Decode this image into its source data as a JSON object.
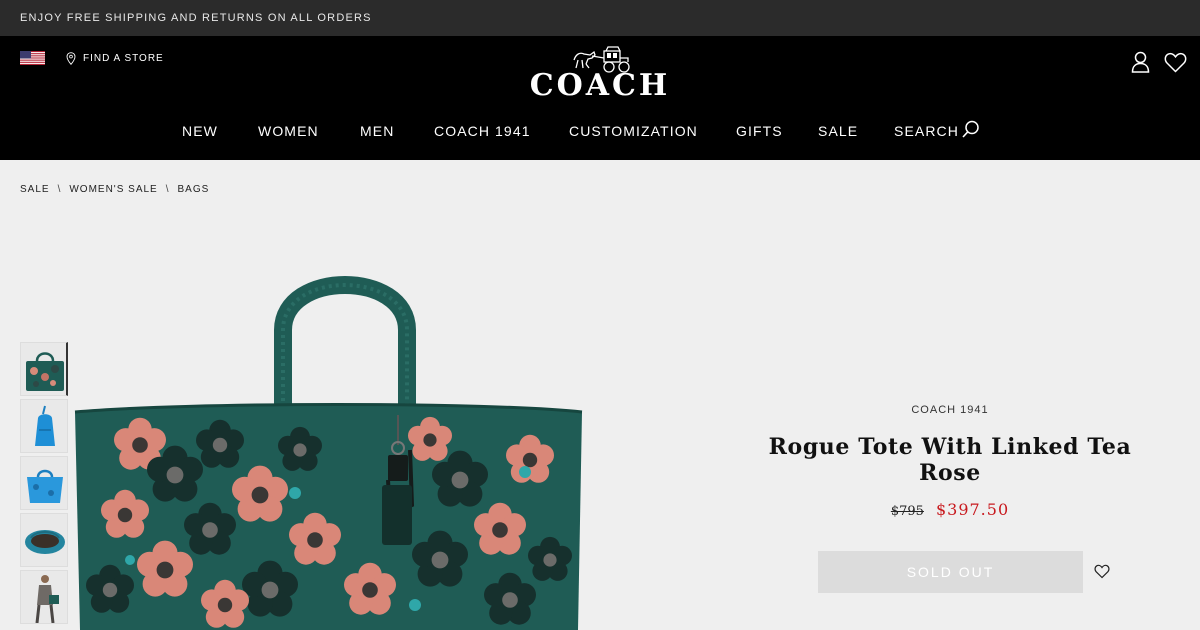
{
  "promo": {
    "text": "ENJOY FREE SHIPPING AND RETURNS ON ALL ORDERS"
  },
  "header": {
    "find_store": "FIND A STORE",
    "logo_text": "COACH",
    "nav": [
      "NEW",
      "WOMEN",
      "MEN",
      "COACH 1941",
      "CUSTOMIZATION",
      "GIFTS",
      "SALE",
      "SEARCH"
    ]
  },
  "breadcrumb": [
    "SALE",
    "WOMEN'S SALE",
    "BAGS"
  ],
  "product": {
    "brand": "COACH 1941",
    "title": "Rogue Tote With Linked Tea Rose",
    "original_price": "$795",
    "sale_price": "$397.50",
    "button": "SOLD OUT"
  },
  "icons": {
    "flag": "us-flag-icon",
    "location": "location-pin-icon",
    "account": "account-icon",
    "wishlist": "heart-icon",
    "search": "search-icon"
  },
  "colors": {
    "promo_bar": "#2b2b2b",
    "header": "#000000",
    "background": "#efefef",
    "bag": "#1f5c55",
    "sale_price": "#c8191e",
    "button": "#dcdcdc"
  }
}
